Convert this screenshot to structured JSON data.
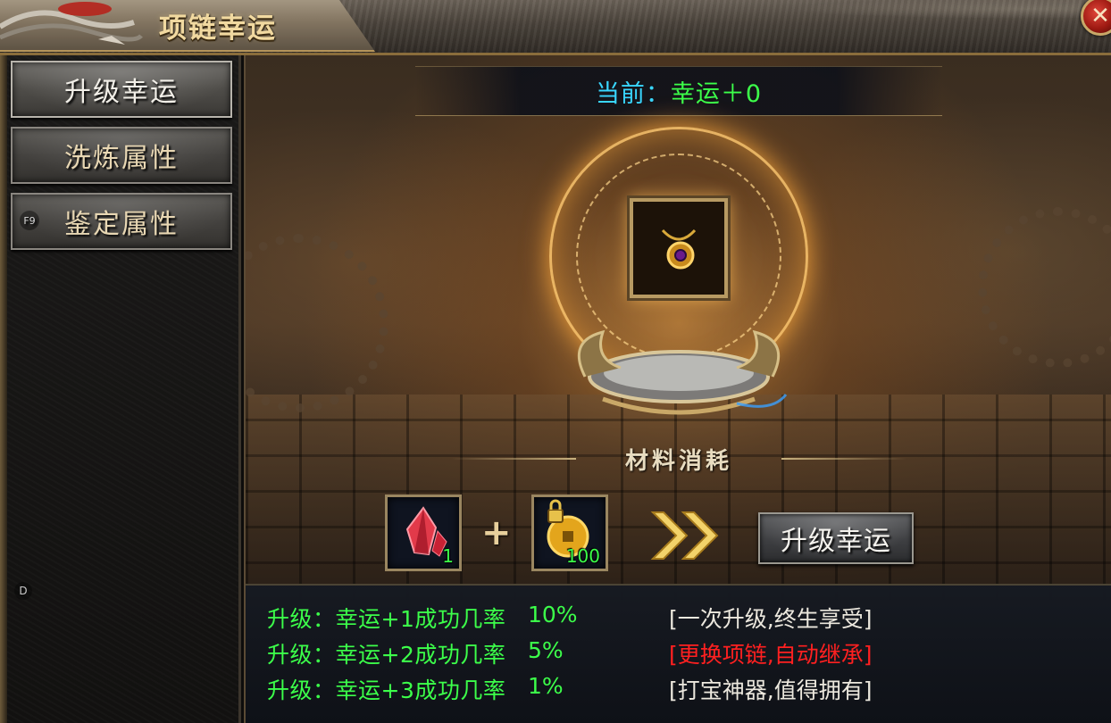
{
  "window": {
    "title": "项链幸运",
    "close_label": "✕"
  },
  "sidebar": {
    "items": [
      {
        "label": "升级幸运",
        "active": true
      },
      {
        "label": "洗炼属性",
        "active": false
      },
      {
        "label": "鉴定属性",
        "active": false,
        "hotkey": "F9"
      }
    ],
    "side_letter": "D"
  },
  "main": {
    "current": {
      "label": "当前：",
      "value": "幸运＋0"
    },
    "materials": {
      "header": "材料消耗",
      "items": [
        {
          "icon": "red-crystal-icon",
          "count": "1"
        },
        {
          "icon": "locked-gold-coin-icon",
          "count": "100"
        }
      ],
      "plus": "+",
      "upgrade_button": "升级幸运"
    },
    "rates": [
      {
        "text": "升级：幸运+1成功几率",
        "percent": "10%",
        "slogan": "[一次升级,终生享受]",
        "slogan_color": "#ece8de"
      },
      {
        "text": "升级：幸运+2成功几率",
        "percent": "5%",
        "slogan": "[更换项链,自动继承]",
        "slogan_color": "#ff2020"
      },
      {
        "text": "升级：幸运+3成功几率",
        "percent": "1%",
        "slogan": "[打宝神器,值得拥有]",
        "slogan_color": "#ece8de"
      }
    ]
  },
  "colors": {
    "accent_green": "#3cff4a",
    "accent_cyan": "#39d6ff",
    "gold": "#c9a868"
  }
}
